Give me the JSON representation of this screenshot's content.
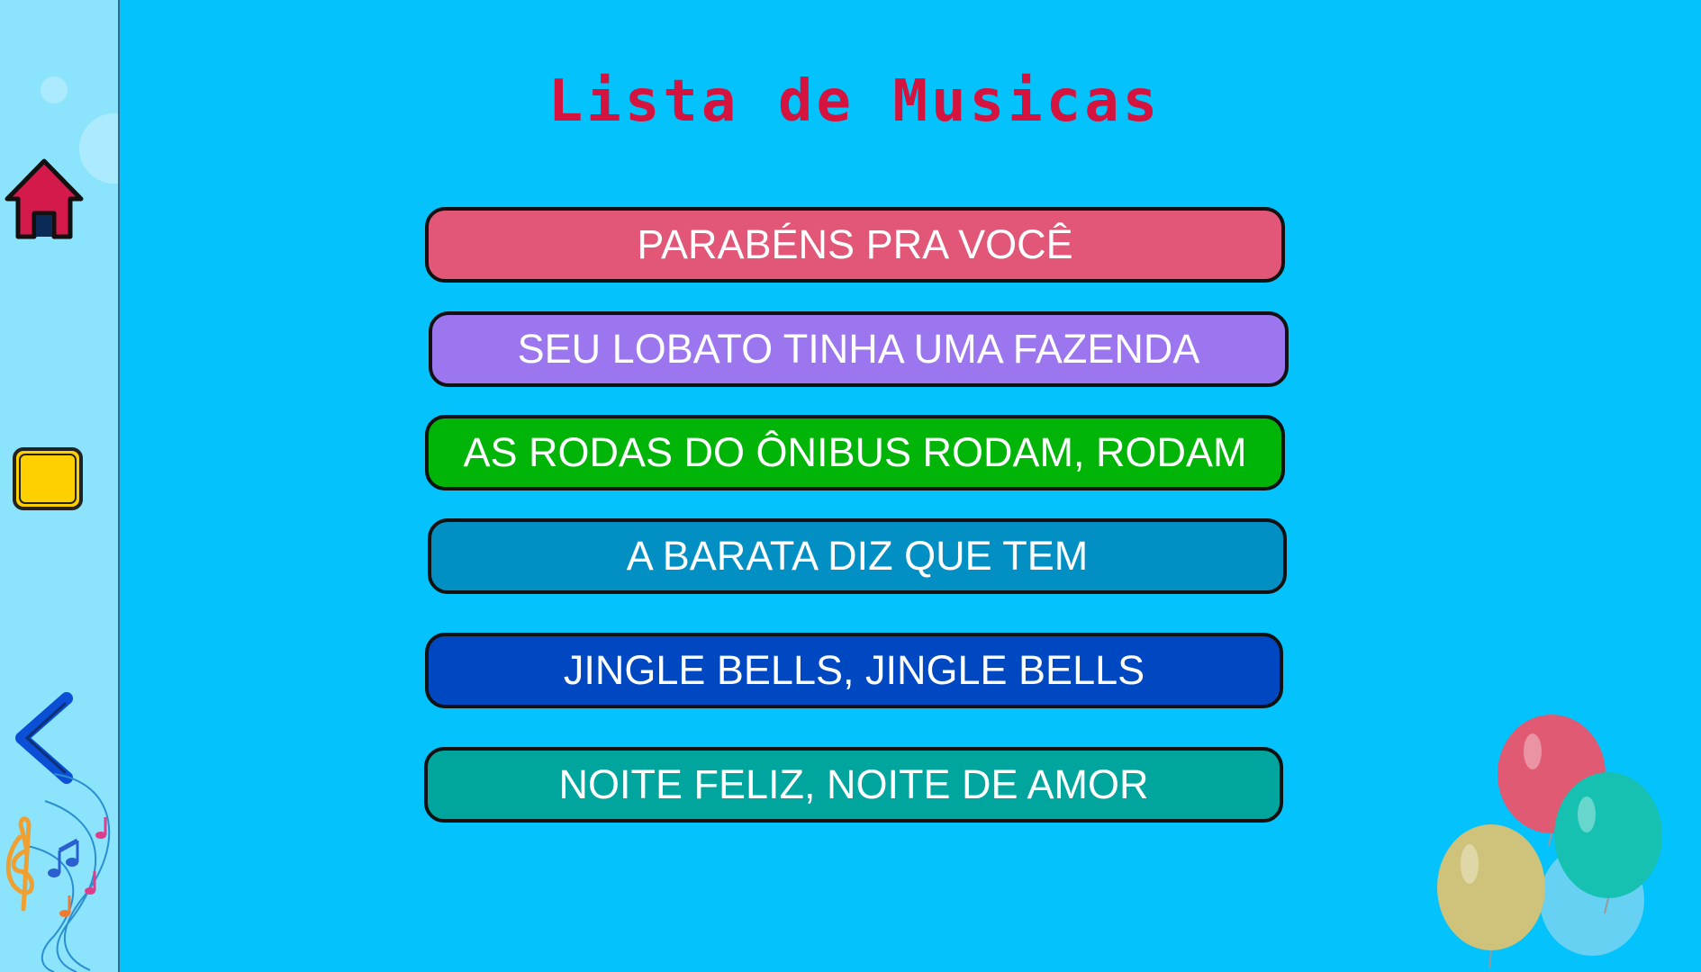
{
  "page": {
    "title": "Lista de Musicas"
  },
  "sidebar": {
    "home_icon": "home-icon",
    "stop_icon": "stop-square-icon",
    "back_icon": "chevron-left-icon",
    "decoration_icon": "music-notes-icon"
  },
  "songs": [
    {
      "label": "PARABÉNS PRA VOCÊ",
      "color": "#e25677"
    },
    {
      "label": "SEU LOBATO TINHA UMA FAZENDA",
      "color": "#9b76ee"
    },
    {
      "label": "AS RODAS DO ÔNIBUS RODAM, RODAM",
      "color": "#00b508"
    },
    {
      "label": "A BARATA DIZ QUE TEM",
      "color": "#0290c4"
    },
    {
      "label": "JINGLE BELLS, JINGLE BELLS",
      "color": "#0048c2"
    },
    {
      "label": "NOITE FELIZ, NOITE DE AMOR",
      "color": "#00a59d"
    }
  ],
  "decoration": {
    "balloons_icon": "balloons-icon"
  },
  "colors": {
    "background": "#04c2fb",
    "sidebar": "#8be4fc",
    "title": "#d4143f"
  }
}
